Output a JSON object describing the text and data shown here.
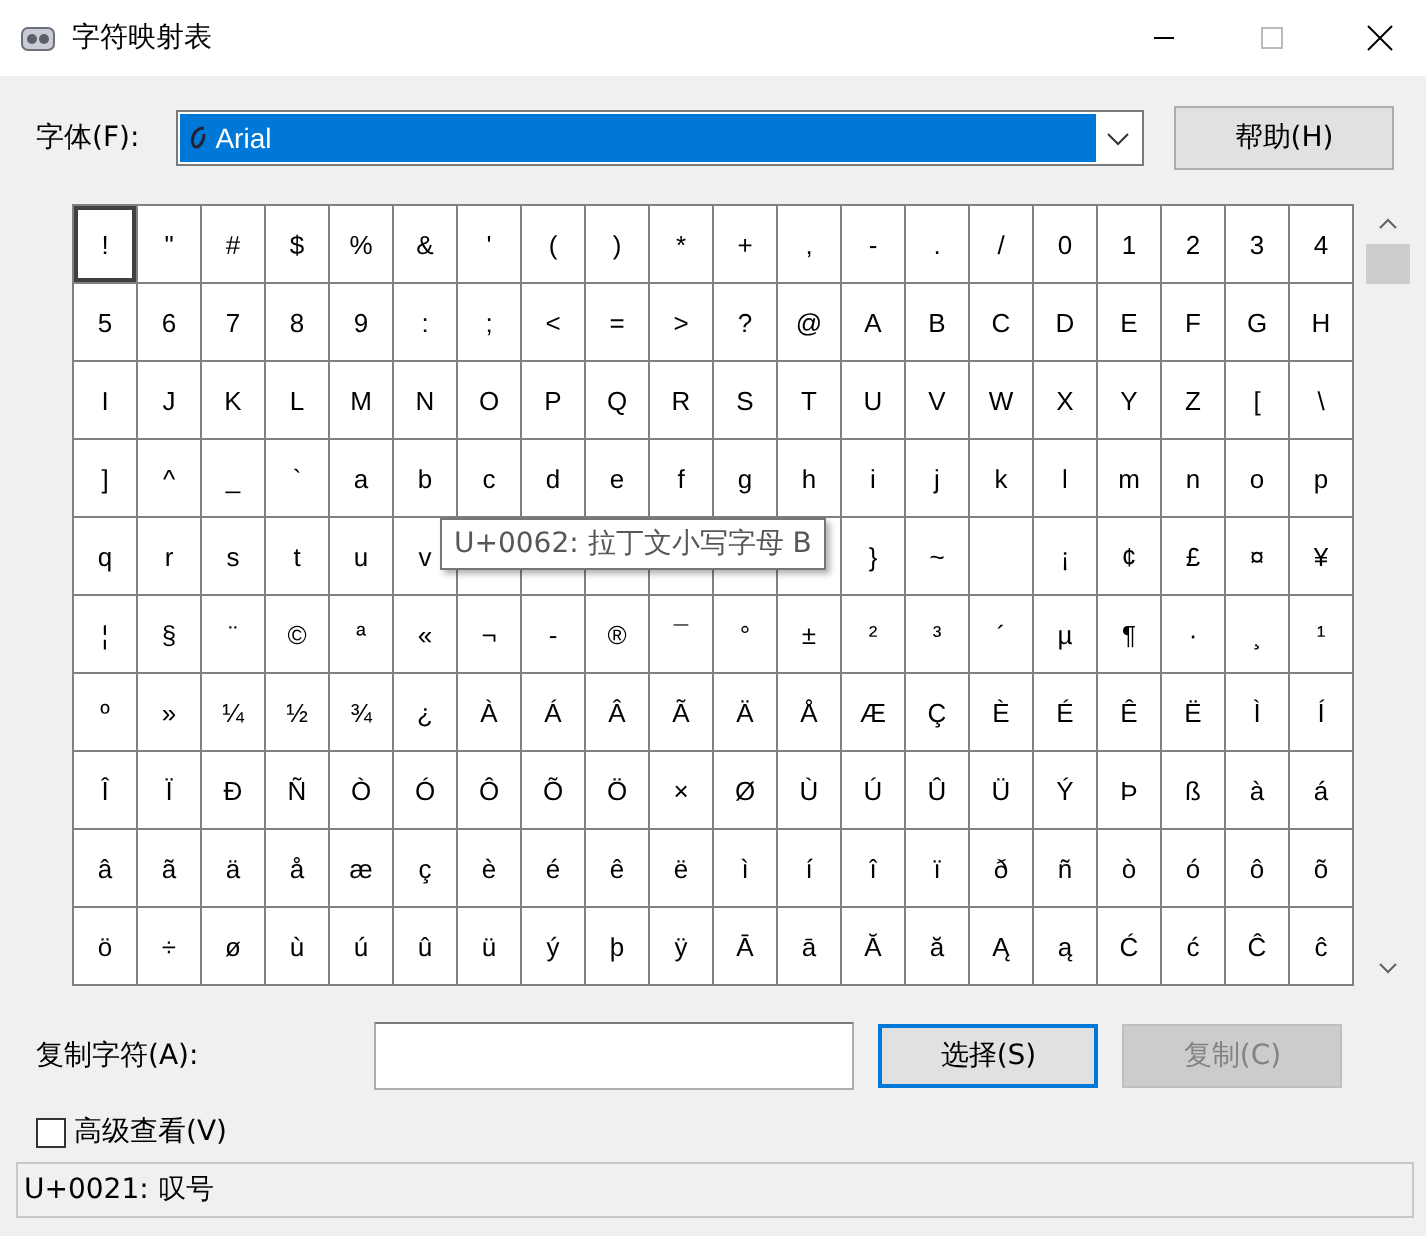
{
  "window": {
    "title": "字符映射表"
  },
  "font": {
    "label": "字体(F):",
    "value": "Arial"
  },
  "help_button": "帮助(H)",
  "grid": {
    "rows": [
      [
        {
          "char": "!",
          "selected": true
        },
        {
          "char": "\"",
          "selected": false
        },
        {
          "char": "#",
          "selected": false
        },
        {
          "char": "$",
          "selected": false
        },
        {
          "char": "%",
          "selected": false
        },
        {
          "char": "&",
          "selected": false
        },
        {
          "char": "'",
          "selected": false
        },
        {
          "char": "(",
          "selected": false
        },
        {
          "char": ")",
          "selected": false
        },
        {
          "char": "*",
          "selected": false
        },
        {
          "char": "+",
          "selected": false
        },
        {
          "char": ",",
          "selected": false
        },
        {
          "char": "-",
          "selected": false
        },
        {
          "char": ".",
          "selected": false
        },
        {
          "char": "/",
          "selected": false
        },
        {
          "char": "0",
          "selected": false
        },
        {
          "char": "1",
          "selected": false
        },
        {
          "char": "2",
          "selected": false
        },
        {
          "char": "3",
          "selected": false
        },
        {
          "char": "4",
          "selected": false
        }
      ],
      [
        {
          "char": "5",
          "selected": false
        },
        {
          "char": "6",
          "selected": false
        },
        {
          "char": "7",
          "selected": false
        },
        {
          "char": "8",
          "selected": false
        },
        {
          "char": "9",
          "selected": false
        },
        {
          "char": ":",
          "selected": false
        },
        {
          "char": ";",
          "selected": false
        },
        {
          "char": "<",
          "selected": false
        },
        {
          "char": "=",
          "selected": false
        },
        {
          "char": ">",
          "selected": false
        },
        {
          "char": "?",
          "selected": false
        },
        {
          "char": "@",
          "selected": false
        },
        {
          "char": "A",
          "selected": false
        },
        {
          "char": "B",
          "selected": false
        },
        {
          "char": "C",
          "selected": false
        },
        {
          "char": "D",
          "selected": false
        },
        {
          "char": "E",
          "selected": false
        },
        {
          "char": "F",
          "selected": false
        },
        {
          "char": "G",
          "selected": false
        },
        {
          "char": "H",
          "selected": false
        }
      ],
      [
        {
          "char": "I",
          "selected": false
        },
        {
          "char": "J",
          "selected": false
        },
        {
          "char": "K",
          "selected": false
        },
        {
          "char": "L",
          "selected": false
        },
        {
          "char": "M",
          "selected": false
        },
        {
          "char": "N",
          "selected": false
        },
        {
          "char": "O",
          "selected": false
        },
        {
          "char": "P",
          "selected": false
        },
        {
          "char": "Q",
          "selected": false
        },
        {
          "char": "R",
          "selected": false
        },
        {
          "char": "S",
          "selected": false
        },
        {
          "char": "T",
          "selected": false
        },
        {
          "char": "U",
          "selected": false
        },
        {
          "char": "V",
          "selected": false
        },
        {
          "char": "W",
          "selected": false
        },
        {
          "char": "X",
          "selected": false
        },
        {
          "char": "Y",
          "selected": false
        },
        {
          "char": "Z",
          "selected": false
        },
        {
          "char": "[",
          "selected": false
        },
        {
          "char": "\\",
          "selected": false
        }
      ],
      [
        {
          "char": "]",
          "selected": false
        },
        {
          "char": "^",
          "selected": false
        },
        {
          "char": "_",
          "selected": false
        },
        {
          "char": "`",
          "selected": false
        },
        {
          "char": "a",
          "selected": false
        },
        {
          "char": "b",
          "selected": false
        },
        {
          "char": "c",
          "selected": false
        },
        {
          "char": "d",
          "selected": false
        },
        {
          "char": "e",
          "selected": false
        },
        {
          "char": "f",
          "selected": false
        },
        {
          "char": "g",
          "selected": false
        },
        {
          "char": "h",
          "selected": false
        },
        {
          "char": "i",
          "selected": false
        },
        {
          "char": "j",
          "selected": false
        },
        {
          "char": "k",
          "selected": false
        },
        {
          "char": "l",
          "selected": false
        },
        {
          "char": "m",
          "selected": false
        },
        {
          "char": "n",
          "selected": false
        },
        {
          "char": "o",
          "selected": false
        },
        {
          "char": "p",
          "selected": false
        }
      ],
      [
        {
          "char": "q",
          "selected": false
        },
        {
          "char": "r",
          "selected": false
        },
        {
          "char": "s",
          "selected": false
        },
        {
          "char": "t",
          "selected": false
        },
        {
          "char": "u",
          "selected": false
        },
        {
          "char": "v",
          "selected": false
        },
        {
          "selected": false
        },
        {
          "selected": false
        },
        {
          "selected": false
        },
        {
          "selected": false
        },
        {
          "selected": false
        },
        {
          "selected": false
        },
        {
          "char": "}",
          "selected": false
        },
        {
          "char": "~",
          "selected": false
        },
        {
          "selected": false
        },
        {
          "char": "¡",
          "selected": false
        },
        {
          "char": "¢",
          "selected": false
        },
        {
          "char": "£",
          "selected": false
        },
        {
          "char": "¤",
          "selected": false
        },
        {
          "char": "¥",
          "selected": false
        }
      ],
      [
        {
          "char": "¦",
          "selected": false
        },
        {
          "char": "§",
          "selected": false
        },
        {
          "char": "¨",
          "selected": false
        },
        {
          "char": "©",
          "selected": false
        },
        {
          "char": "ª",
          "selected": false
        },
        {
          "char": "«",
          "selected": false
        },
        {
          "char": "¬",
          "selected": false
        },
        {
          "char": "-",
          "selected": false
        },
        {
          "char": "®",
          "selected": false
        },
        {
          "char": "¯",
          "selected": false
        },
        {
          "char": "°",
          "selected": false
        },
        {
          "char": "±",
          "selected": false
        },
        {
          "char": "²",
          "selected": false
        },
        {
          "char": "³",
          "selected": false
        },
        {
          "char": "´",
          "selected": false
        },
        {
          "char": "µ",
          "selected": false
        },
        {
          "char": "¶",
          "selected": false
        },
        {
          "char": "·",
          "selected": false
        },
        {
          "char": "¸",
          "selected": false
        },
        {
          "char": "¹",
          "selected": false
        }
      ],
      [
        {
          "char": "º",
          "selected": false
        },
        {
          "char": "»",
          "selected": false
        },
        {
          "char": "¼",
          "selected": false
        },
        {
          "char": "½",
          "selected": false
        },
        {
          "char": "¾",
          "selected": false
        },
        {
          "char": "¿",
          "selected": false
        },
        {
          "char": "À",
          "selected": false
        },
        {
          "char": "Á",
          "selected": false
        },
        {
          "char": "Â",
          "selected": false
        },
        {
          "char": "Ã",
          "selected": false
        },
        {
          "char": "Ä",
          "selected": false
        },
        {
          "char": "Å",
          "selected": false
        },
        {
          "char": "Æ",
          "selected": false
        },
        {
          "char": "Ç",
          "selected": false
        },
        {
          "char": "È",
          "selected": false
        },
        {
          "char": "É",
          "selected": false
        },
        {
          "char": "Ê",
          "selected": false
        },
        {
          "char": "Ë",
          "selected": false
        },
        {
          "char": "Ì",
          "selected": false
        },
        {
          "char": "Í",
          "selected": false
        }
      ],
      [
        {
          "char": "Î",
          "selected": false
        },
        {
          "char": "Ï",
          "selected": false
        },
        {
          "char": "Ð",
          "selected": false
        },
        {
          "char": "Ñ",
          "selected": false
        },
        {
          "char": "Ò",
          "selected": false
        },
        {
          "char": "Ó",
          "selected": false
        },
        {
          "char": "Ô",
          "selected": false
        },
        {
          "char": "Õ",
          "selected": false
        },
        {
          "char": "Ö",
          "selected": false
        },
        {
          "char": "×",
          "selected": false
        },
        {
          "char": "Ø",
          "selected": false
        },
        {
          "char": "Ù",
          "selected": false
        },
        {
          "char": "Ú",
          "selected": false
        },
        {
          "char": "Û",
          "selected": false
        },
        {
          "char": "Ü",
          "selected": false
        },
        {
          "char": "Ý",
          "selected": false
        },
        {
          "char": "Þ",
          "selected": false
        },
        {
          "char": "ß",
          "selected": false
        },
        {
          "char": "à",
          "selected": false
        },
        {
          "char": "á",
          "selected": false
        }
      ],
      [
        {
          "char": "â",
          "selected": false
        },
        {
          "char": "ã",
          "selected": false
        },
        {
          "char": "ä",
          "selected": false
        },
        {
          "char": "å",
          "selected": false
        },
        {
          "char": "æ",
          "selected": false
        },
        {
          "char": "ç",
          "selected": false
        },
        {
          "char": "è",
          "selected": false
        },
        {
          "char": "é",
          "selected": false
        },
        {
          "char": "ê",
          "selected": false
        },
        {
          "char": "ë",
          "selected": false
        },
        {
          "char": "ì",
          "selected": false
        },
        {
          "char": "í",
          "selected": false
        },
        {
          "char": "î",
          "selected": false
        },
        {
          "char": "ï",
          "selected": false
        },
        {
          "char": "ð",
          "selected": false
        },
        {
          "char": "ñ",
          "selected": false
        },
        {
          "char": "ò",
          "selected": false
        },
        {
          "char": "ó",
          "selected": false
        },
        {
          "char": "ô",
          "selected": false
        },
        {
          "char": "õ",
          "selected": false
        }
      ],
      [
        {
          "char": "ö",
          "selected": false
        },
        {
          "char": "÷",
          "selected": false
        },
        {
          "char": "ø",
          "selected": false
        },
        {
          "char": "ù",
          "selected": false
        },
        {
          "char": "ú",
          "selected": false
        },
        {
          "char": "û",
          "selected": false
        },
        {
          "char": "ü",
          "selected": false
        },
        {
          "char": "ý",
          "selected": false
        },
        {
          "char": "þ",
          "selected": false
        },
        {
          "char": "ÿ",
          "selected": false
        },
        {
          "char": "Ā",
          "selected": false
        },
        {
          "char": "ā",
          "selected": false
        },
        {
          "char": "Ă",
          "selected": false
        },
        {
          "char": "ă",
          "selected": false
        },
        {
          "char": "Ą",
          "selected": false
        },
        {
          "char": "ą",
          "selected": false
        },
        {
          "char": "Ć",
          "selected": false
        },
        {
          "char": "ć",
          "selected": false
        },
        {
          "char": "Ĉ",
          "selected": false
        },
        {
          "char": "ĉ",
          "selected": false
        }
      ]
    ],
    "tooltip": "U+0062: 拉丁文小写字母 B"
  },
  "copy": {
    "label": "复制字符(A):",
    "select_button": {
      "label": "选择(S)",
      "disabled": false
    },
    "copy_button": {
      "label": "复制(C)",
      "disabled": true
    }
  },
  "advanced": {
    "label": "高级查看(V)",
    "checked": false
  },
  "status_bar": "U+0021: 叹号"
}
